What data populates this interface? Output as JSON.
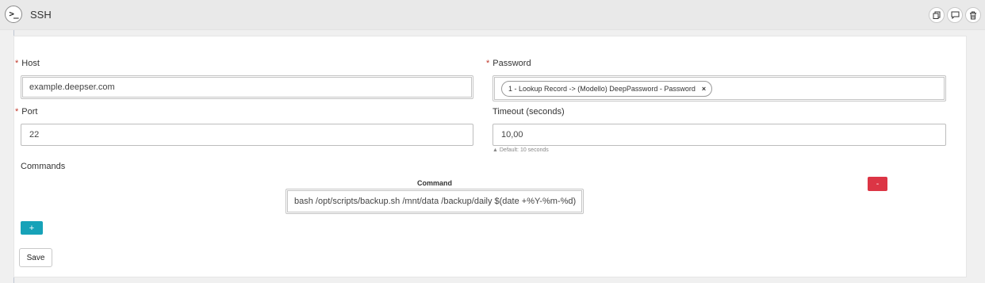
{
  "header": {
    "icon": "terminal-icon",
    "title": "SSH",
    "actions": [
      "copy-icon",
      "comment-icon",
      "trash-icon"
    ]
  },
  "form": {
    "host": {
      "label": "Host",
      "required": "*",
      "value": "example.deepser.com"
    },
    "password": {
      "label": "Password",
      "required": "*",
      "chip": "1 - Lookup Record -> (Modello) DeepPassword - Password",
      "chip_remove": "×"
    },
    "port": {
      "label": "Port",
      "required": "*",
      "value": "22"
    },
    "timeout": {
      "label": "Timeout (seconds)",
      "value": "10,00",
      "hint": "▲ Default: 10 seconds"
    },
    "commands": {
      "label": "Commands",
      "column_header": "Command",
      "rows": [
        {
          "value": "bash /opt/scripts/backup.sh /mnt/data /backup/daily $(date +%Y-%m-%d)",
          "remove_label": "-"
        }
      ],
      "add_label": "+"
    }
  },
  "save_label": "Save",
  "colors": {
    "danger": "#dc3545",
    "info": "#17a2b8",
    "required": "#c0392b"
  }
}
